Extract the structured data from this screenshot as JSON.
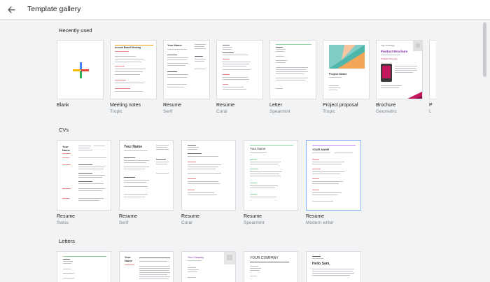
{
  "header": {
    "title": "Template gallery",
    "back_icon": "arrow-back-icon"
  },
  "sections": {
    "recent": "Recently used",
    "cvs": "CVs",
    "letters": "Letters"
  },
  "recent": [
    {
      "name": "Blank",
      "sub": ""
    },
    {
      "name": "Meeting notes",
      "sub": "Tropic"
    },
    {
      "name": "Resume",
      "sub": "Serif"
    },
    {
      "name": "Resume",
      "sub": "Coral"
    },
    {
      "name": "Letter",
      "sub": "Spearmint"
    },
    {
      "name": "Project proposal",
      "sub": "Tropic"
    },
    {
      "name": "Brochure",
      "sub": "Geometric"
    },
    {
      "name": "P",
      "sub": "L"
    }
  ],
  "cvs": [
    {
      "name": "Resume",
      "sub": "Swiss"
    },
    {
      "name": "Resume",
      "sub": "Serif"
    },
    {
      "name": "Resume",
      "sub": "Coral"
    },
    {
      "name": "Resume",
      "sub": "Spearmint"
    },
    {
      "name": "Resume",
      "sub": "Modern writer"
    }
  ],
  "thumb_text": {
    "meeting": "Annual Board Meeting",
    "serif_name": "Your Name",
    "proposal": "Project Name",
    "brochure_co": "Your Company",
    "brochure_title": "Product Brochure",
    "brochure_sub": "Product Overview",
    "swiss_name": "Your Name",
    "cv_serif_name": "Your Name",
    "cv_spear_name": "Your Name",
    "cv_mw_name": "YOUR NAME",
    "l2_name": "Your Name",
    "l3_co": "Your Company",
    "l4_co": "YOUR COMPANY",
    "l5_hello": "Hello Sam,"
  },
  "colors": {
    "accent_red": "#e94235",
    "accent_green": "#34a853",
    "accent_blue": "#4285f4",
    "accent_yellow": "#fbbc04",
    "brochure_pink": "#c2185b",
    "proposal_teal": "#7fcdc6",
    "proposal_orange": "#f2a65a"
  }
}
